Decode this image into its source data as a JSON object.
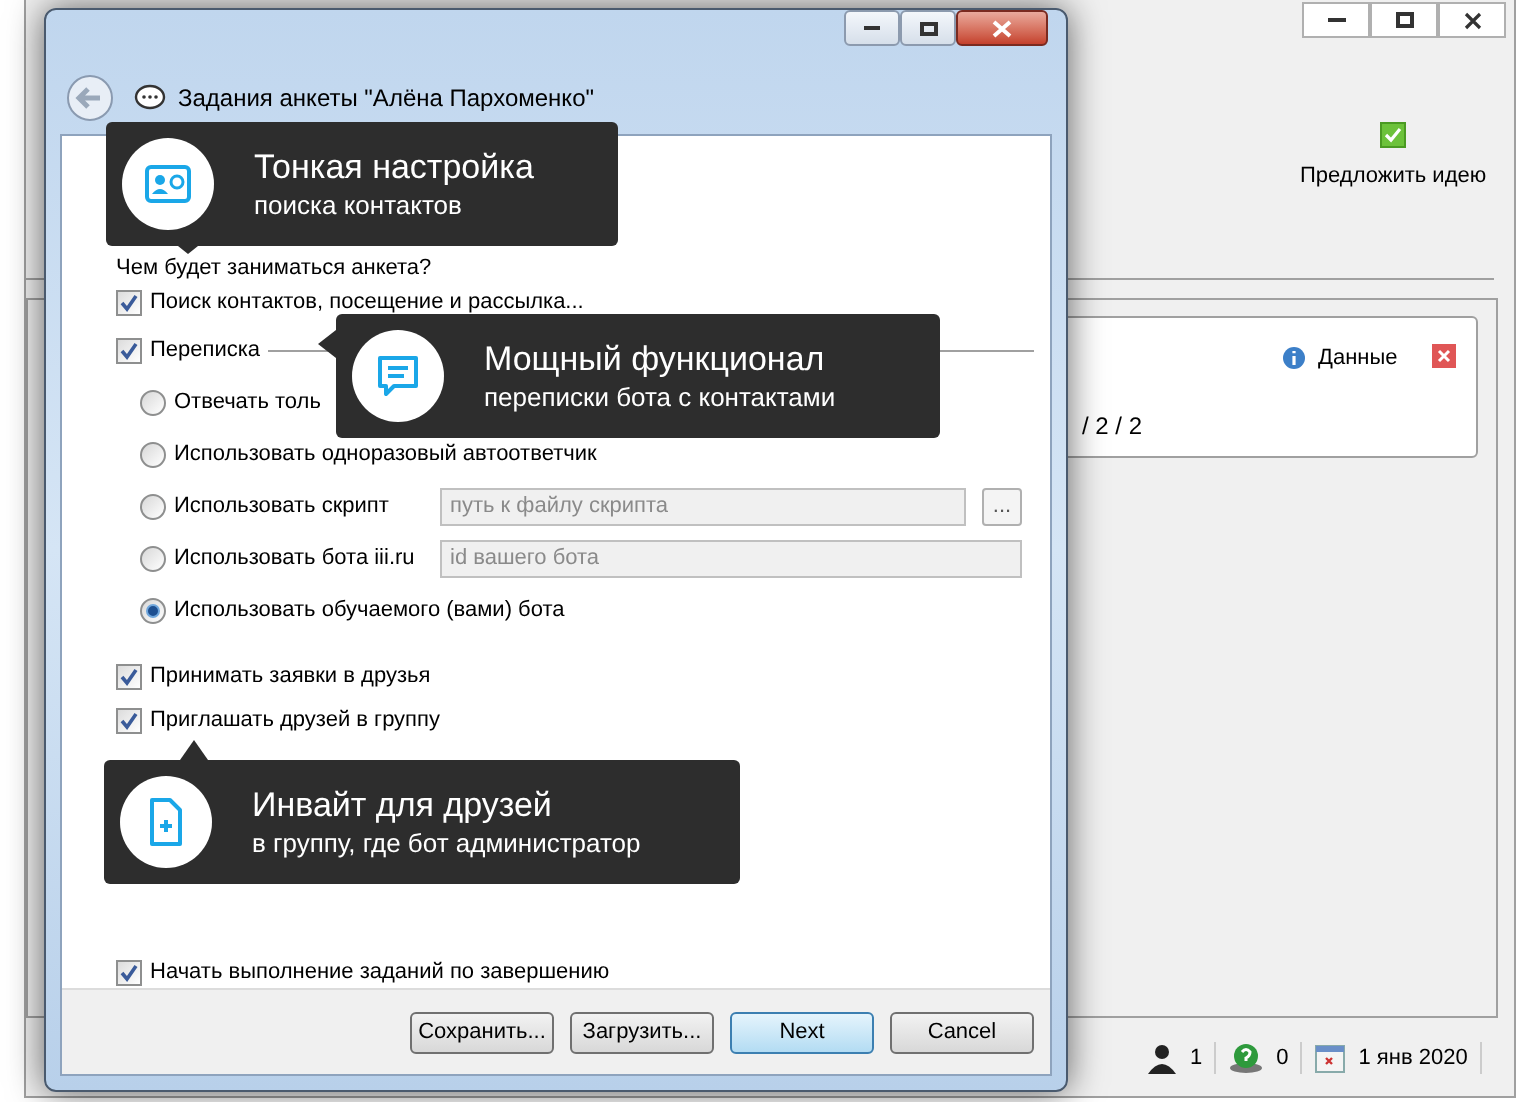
{
  "background_app": {
    "toolbar_action": "Предложить идею",
    "panel": {
      "info_label": "Данные",
      "counter": "/ 2 / 2"
    },
    "status_bar": {
      "users_count": "1",
      "queue_count": "0",
      "date": "1 янв 2020"
    }
  },
  "dialog": {
    "title": "Задания анкеты \"Алёна Пархоменко\"",
    "question": "Чем будет заниматься анкета?",
    "tasks": [
      {
        "label": "Поиск контактов, посещение и рассылка...",
        "checked": true
      },
      {
        "label": "Переписка",
        "checked": true
      }
    ],
    "reply_modes": [
      {
        "label": "Отвечать толь",
        "selected": false
      },
      {
        "label": "Использовать одноразовый автоответчик",
        "selected": false
      },
      {
        "label": "Использовать скрипт",
        "selected": false,
        "field": {
          "placeholder": "путь к файлу скрипта",
          "browse": "..."
        }
      },
      {
        "label": "Использовать бота iii.ru",
        "selected": false,
        "field": {
          "placeholder": "id вашего бота"
        }
      },
      {
        "label": "Использовать обучаемого (вами) бота",
        "selected": true
      }
    ],
    "extra_tasks": [
      {
        "label": "Принимать заявки в друзья",
        "checked": true
      },
      {
        "label": "Приглашать друзей в группу",
        "checked": true
      }
    ],
    "start_option": {
      "label": "Начать выполнение заданий по завершению",
      "checked": true
    },
    "buttons": [
      {
        "label": "Сохранить...",
        "default": false
      },
      {
        "label": "Загрузить...",
        "default": false
      },
      {
        "label": "Next",
        "default": true
      },
      {
        "label": "Cancel",
        "default": false
      }
    ]
  },
  "tooltips": [
    {
      "kind": "contact-card",
      "title": "Тонкая настройка",
      "subtitle": "поиска контактов"
    },
    {
      "kind": "chat",
      "title": "Мощный функционал",
      "subtitle": "переписки бота с контактами"
    },
    {
      "kind": "add-file",
      "title": "Инвайт для друзей",
      "subtitle": "в группу, где бот администратор"
    }
  ]
}
